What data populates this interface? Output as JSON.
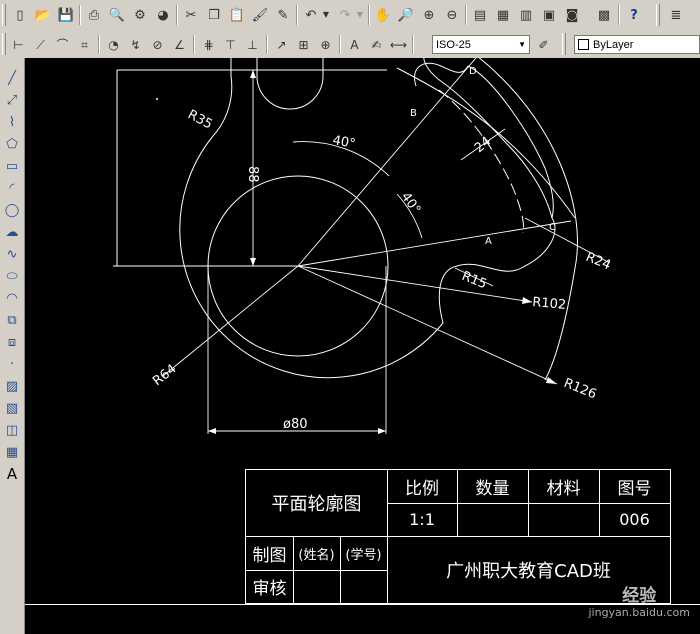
{
  "toolbar_std": {
    "buttons": [
      "new-icon",
      "open-icon",
      "save-icon",
      "print-icon",
      "plot-preview-icon",
      "publish-icon",
      "3d-dwf-icon",
      "cut-icon",
      "copy-icon",
      "paste-icon",
      "match-properties-icon",
      "block-editor-icon",
      "undo-icon",
      "redo-icon",
      "pan-icon",
      "zoom-realtime-icon",
      "zoom-window-icon",
      "zoom-previous-icon",
      "properties-icon",
      "design-center-icon",
      "tool-palettes-icon",
      "sheet-set-icon",
      "markup-icon",
      "calculator-icon",
      "help-icon"
    ]
  },
  "toolbar_dim": {
    "style_value": "ISO-25",
    "layer_value": "ByLayer"
  },
  "draw_tools": [
    "line-icon",
    "construction-line-icon",
    "polyline-icon",
    "polygon-icon",
    "rectangle-icon",
    "arc-icon",
    "circle-icon",
    "revision-cloud-icon",
    "spline-icon",
    "ellipse-icon",
    "ellipse-arc-icon",
    "insert-block-icon",
    "make-block-icon",
    "point-icon",
    "hatch-icon",
    "gradient-icon",
    "region-icon",
    "table-icon",
    "multiline-text-icon"
  ],
  "draw_tools_text": "A",
  "drawing": {
    "labels": {
      "r35": "R35",
      "d88": "88",
      "a40a": "40°",
      "a40b": "40°",
      "d24": "24",
      "pt_a": "A",
      "pt_b": "B",
      "pt_c": "C",
      "pt_d": "D",
      "r24": "R24",
      "r15": "R15",
      "r102": "R102",
      "r126": "R126",
      "r64": "R64",
      "phi80": "ø80"
    }
  },
  "title_block": {
    "name": "平面轮廓图",
    "h_scale": "比例",
    "h_qty": "数量",
    "h_mat": "材料",
    "h_no": "图号",
    "v_scale": "1:1",
    "v_no": "006",
    "drawn_by": "制图",
    "name_ph": "(姓名)",
    "id_ph": "(学号)",
    "reviewed": "审核",
    "org": "广州职大教育CAD班"
  },
  "watermark": {
    "brand": "经验",
    "url": "jingyan.baidu.com"
  }
}
